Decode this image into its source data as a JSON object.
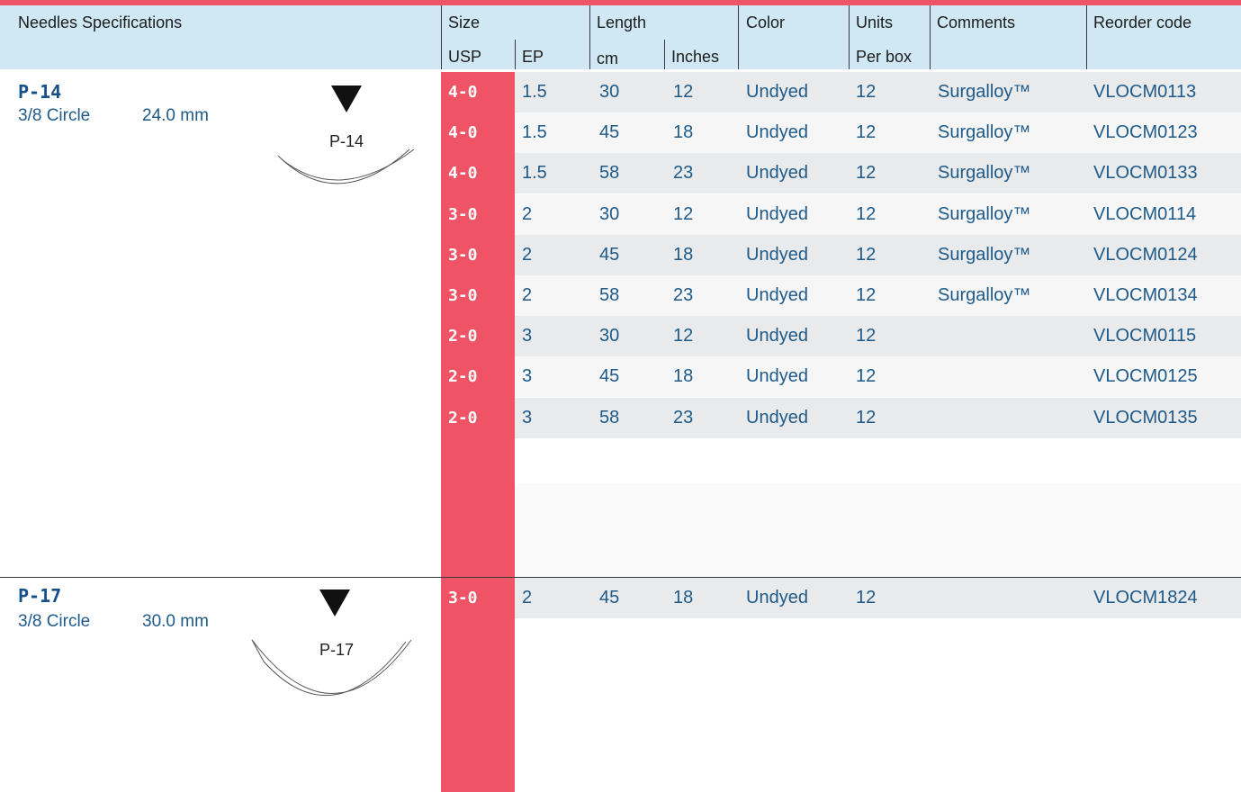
{
  "header": {
    "needles_specifications": "Needles Specifications",
    "size": "Size",
    "usp": "USP",
    "ep": "EP",
    "length": "Length",
    "cm": "cm",
    "inches": "Inches",
    "color": "Color",
    "units": "Units",
    "per_box": "Per box",
    "comments": "Comments",
    "reorder_code": "Reorder code"
  },
  "colors": {
    "accent_red": "#ef5466",
    "header_blue": "#cfe8f4",
    "text_blue": "#1d5a8a"
  },
  "needles": [
    {
      "name": "P-14",
      "shape": "3/8 Circle",
      "length": "24.0 mm",
      "icon_label": "P-14",
      "rows": [
        {
          "usp": "4-0",
          "ep": "1.5",
          "cm": "30",
          "inches": "12",
          "color": "Undyed",
          "units": "12",
          "comments": "Surgalloy™",
          "code": "VLOCM0113"
        },
        {
          "usp": "4-0",
          "ep": "1.5",
          "cm": "45",
          "inches": "18",
          "color": "Undyed",
          "units": "12",
          "comments": "Surgalloy™",
          "code": "VLOCM0123"
        },
        {
          "usp": "4-0",
          "ep": "1.5",
          "cm": "58",
          "inches": "23",
          "color": "Undyed",
          "units": "12",
          "comments": "Surgalloy™",
          "code": "VLOCM0133"
        },
        {
          "usp": "3-0",
          "ep": "2",
          "cm": "30",
          "inches": "12",
          "color": "Undyed",
          "units": "12",
          "comments": "Surgalloy™",
          "code": "VLOCM0114"
        },
        {
          "usp": "3-0",
          "ep": "2",
          "cm": "45",
          "inches": "18",
          "color": "Undyed",
          "units": "12",
          "comments": "Surgalloy™",
          "code": "VLOCM0124"
        },
        {
          "usp": "3-0",
          "ep": "2",
          "cm": "58",
          "inches": "23",
          "color": "Undyed",
          "units": "12",
          "comments": "Surgalloy™",
          "code": "VLOCM0134"
        },
        {
          "usp": "2-0",
          "ep": "3",
          "cm": "30",
          "inches": "12",
          "color": "Undyed",
          "units": "12",
          "comments": "",
          "code": "VLOCM0115"
        },
        {
          "usp": "2-0",
          "ep": "3",
          "cm": "45",
          "inches": "18",
          "color": "Undyed",
          "units": "12",
          "comments": "",
          "code": "VLOCM0125"
        },
        {
          "usp": "2-0",
          "ep": "3",
          "cm": "58",
          "inches": "23",
          "color": "Undyed",
          "units": "12",
          "comments": "",
          "code": "VLOCM0135"
        }
      ]
    },
    {
      "name": "P-17",
      "shape": "3/8 Circle",
      "length": "30.0 mm",
      "icon_label": "P-17",
      "rows": [
        {
          "usp": "3-0",
          "ep": "2",
          "cm": "45",
          "inches": "18",
          "color": "Undyed",
          "units": "12",
          "comments": "",
          "code": "VLOCM1824"
        }
      ]
    }
  ]
}
